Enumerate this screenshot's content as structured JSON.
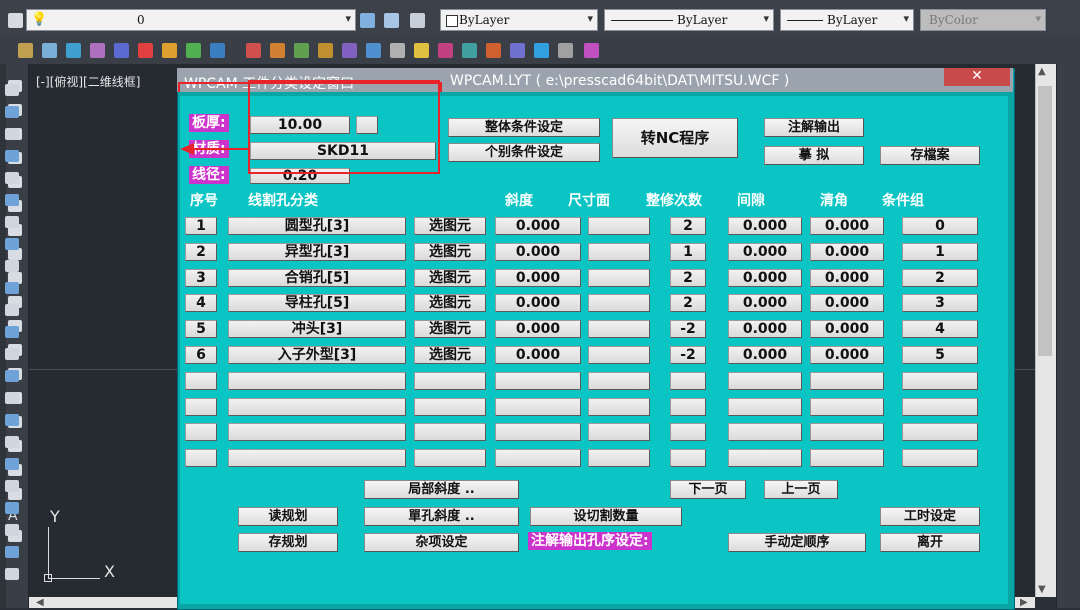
{
  "toolbar": {
    "layer_value": "0",
    "color_value": "ByLayer",
    "linetype_value": "ByLayer",
    "lineweight_value": "ByLayer",
    "plotstyle_value": "ByColor"
  },
  "viewport": {
    "label": "[-][俯视][二维线框]",
    "y_axis": "Y",
    "x_axis": "X"
  },
  "dialog": {
    "title_left": "WPCAM  工件分类设定窗口",
    "title_right": "WPCAM.LYT ( e:\\presscad64bit\\DAT\\MITSU.WCF )",
    "close_glyph": "✕",
    "plate_label": "板厚:",
    "plate_value": "10.00",
    "material_label": "材质:",
    "material_value": "SKD11",
    "wire_label": "线径:",
    "wire_value": "0.20",
    "btn_overall": "整体条件设定",
    "btn_individual": "个别条件设定",
    "btn_to_nc": "转NC程序",
    "btn_annot": "注解输出",
    "btn_simulate": "摹 拟",
    "btn_save": "存檔案",
    "headers": {
      "seq": "序号",
      "category": "线割孔分类",
      "taper": "斜度",
      "size_face": "尺寸面",
      "trim_count": "整修次数",
      "gap": "间隙",
      "corner": "清角",
      "cond_group": "条件组"
    },
    "rows": [
      {
        "no": "1",
        "name": "圆型孔[3]",
        "pick": "选图元",
        "taper": "0.000",
        "face": "",
        "trim": "2",
        "gap": "0.000",
        "corner": "0.000",
        "group": "0"
      },
      {
        "no": "2",
        "name": "异型孔[3]",
        "pick": "选图元",
        "taper": "0.000",
        "face": "",
        "trim": "1",
        "gap": "0.000",
        "corner": "0.000",
        "group": "1"
      },
      {
        "no": "3",
        "name": "合销孔[5]",
        "pick": "选图元",
        "taper": "0.000",
        "face": "",
        "trim": "2",
        "gap": "0.000",
        "corner": "0.000",
        "group": "2"
      },
      {
        "no": "4",
        "name": "导柱孔[5]",
        "pick": "选图元",
        "taper": "0.000",
        "face": "",
        "trim": "2",
        "gap": "0.000",
        "corner": "0.000",
        "group": "3"
      },
      {
        "no": "5",
        "name": "冲头[3]",
        "pick": "选图元",
        "taper": "0.000",
        "face": "",
        "trim": "-2",
        "gap": "0.000",
        "corner": "0.000",
        "group": "4"
      },
      {
        "no": "6",
        "name": "入子外型[3]",
        "pick": "选图元",
        "taper": "0.000",
        "face": "",
        "trim": "-2",
        "gap": "0.000",
        "corner": "0.000",
        "group": "5"
      },
      {
        "no": "",
        "name": "",
        "pick": "",
        "taper": "",
        "face": "",
        "trim": "",
        "gap": "",
        "corner": "",
        "group": ""
      },
      {
        "no": "",
        "name": "",
        "pick": "",
        "taper": "",
        "face": "",
        "trim": "",
        "gap": "",
        "corner": "",
        "group": ""
      },
      {
        "no": "",
        "name": "",
        "pick": "",
        "taper": "",
        "face": "",
        "trim": "",
        "gap": "",
        "corner": "",
        "group": ""
      },
      {
        "no": "",
        "name": "",
        "pick": "",
        "taper": "",
        "face": "",
        "trim": "",
        "gap": "",
        "corner": "",
        "group": ""
      }
    ],
    "btn_local_taper": "局部斜度 ..",
    "btn_next": "下一页",
    "btn_prev": "上一页",
    "btn_read": "读规划",
    "btn_single_taper": "單孔斜度 ..",
    "btn_cut_count": "设切割数量",
    "btn_worktime": "工时设定",
    "btn_store": "存规划",
    "btn_misc": "杂项设定",
    "annot_order_label": "注解输出孔序设定:",
    "btn_manual_order": "手动定顺序",
    "btn_exit": "离开"
  }
}
